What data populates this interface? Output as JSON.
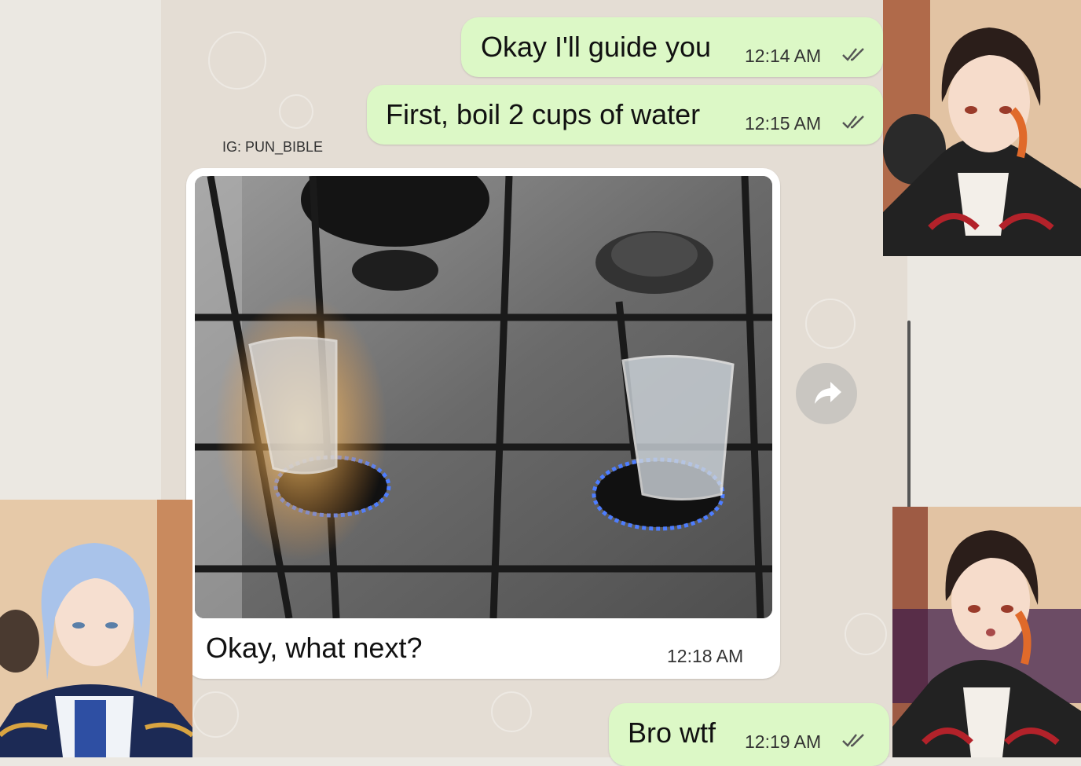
{
  "watermark": "IG: PUN_BIBLE",
  "messages": [
    {
      "text": "Okay I'll guide you",
      "time": "12:14 AM",
      "direction": "outgoing",
      "status": "read"
    },
    {
      "text": "First, boil 2 cups of water",
      "time": "12:15 AM",
      "direction": "outgoing",
      "status": "read"
    },
    {
      "text": "Okay, what next?",
      "time": "12:18 AM",
      "direction": "incoming",
      "attachment": "photo"
    },
    {
      "text": "Bro wtf",
      "time": "12:19 AM",
      "direction": "outgoing",
      "status": "read"
    }
  ],
  "icons": {
    "forward": "forward-arrow-icon",
    "ticks": "double-check-icon"
  },
  "colors": {
    "outgoing_bubble": "#dcf8c6",
    "incoming_bubble": "#ffffff",
    "chat_bg": "#e4ddd4",
    "flame_blue": "#4d7dff"
  }
}
